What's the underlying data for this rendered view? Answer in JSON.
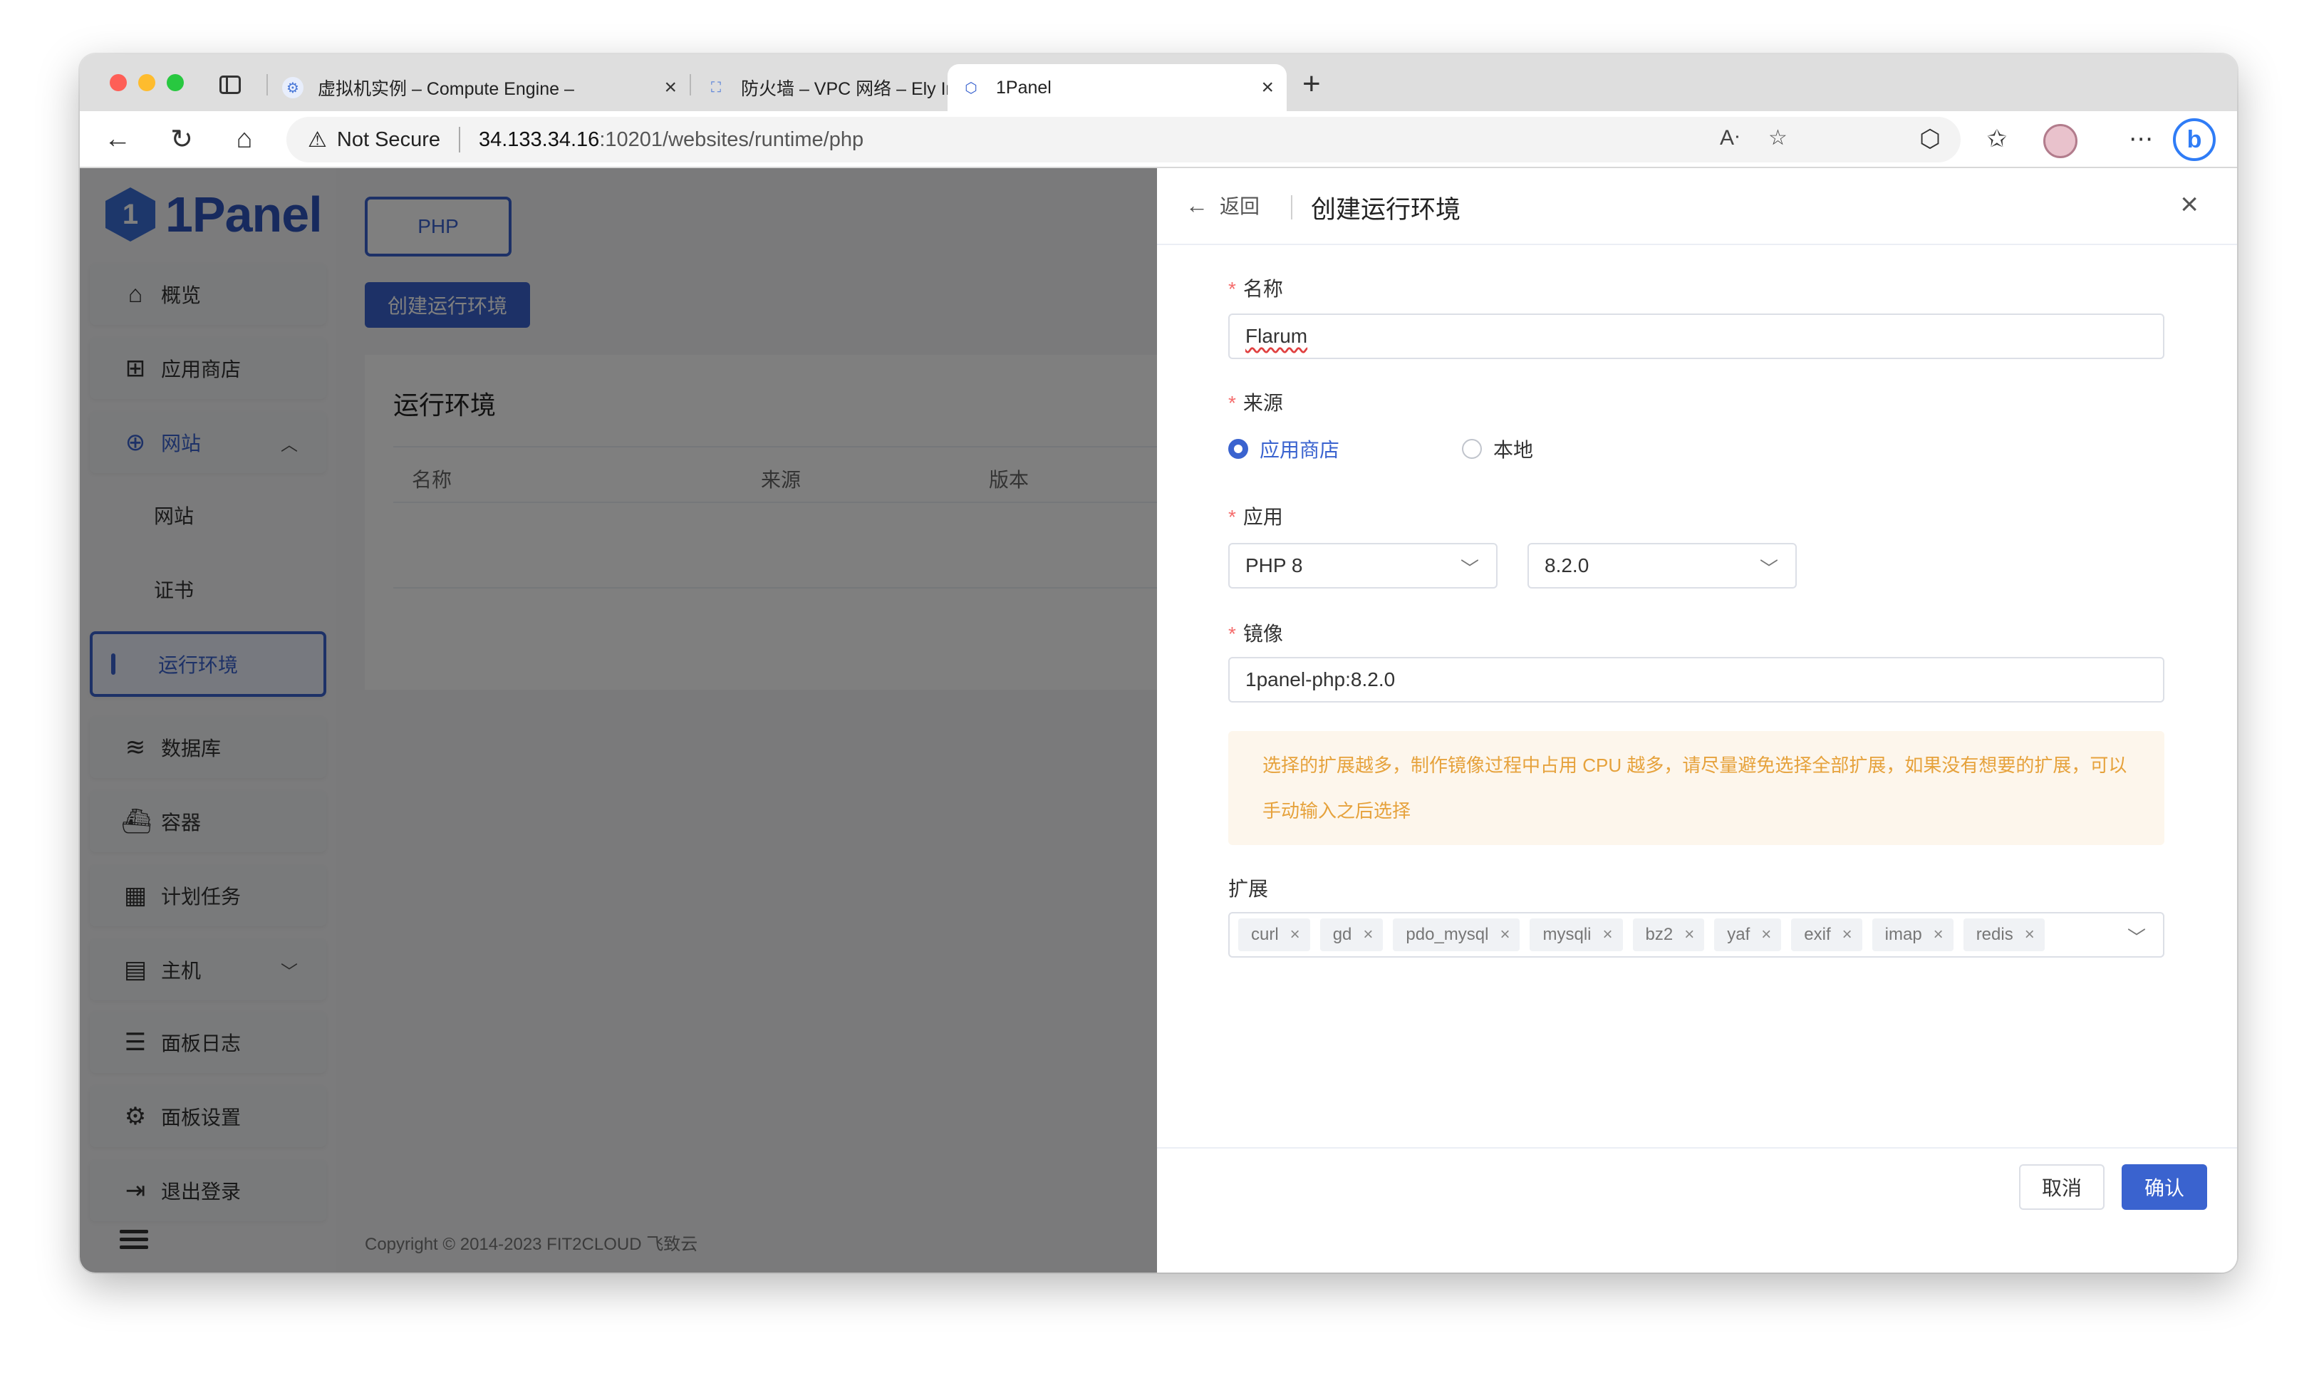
{
  "browser": {
    "tabs": [
      {
        "title": "虚拟机实例 – Compute Engine – ",
        "icon": "compute-engine-icon"
      },
      {
        "title": "防火墙 – VPC 网络 – Ely Internal",
        "icon": "vpc-network-icon"
      },
      {
        "title": "1Panel",
        "icon": "1panel-icon",
        "active": true
      }
    ],
    "security_label": "Not Secure",
    "url_host": "34.133.34.16",
    "url_path": ":10201/websites/runtime/php"
  },
  "sidebar": {
    "logo_text": "1Panel",
    "items": [
      {
        "label": "概览",
        "icon": "home-icon"
      },
      {
        "label": "应用商店",
        "icon": "grid-icon"
      },
      {
        "label": "网站",
        "icon": "globe-icon",
        "expanded": true
      },
      {
        "label": "网站"
      },
      {
        "label": "证书"
      },
      {
        "label": "运行环境",
        "active": true
      },
      {
        "label": "数据库",
        "icon": "layers-icon"
      },
      {
        "label": "容器",
        "icon": "docker-icon"
      },
      {
        "label": "计划任务",
        "icon": "calendar-icon"
      },
      {
        "label": "主机",
        "icon": "server-icon"
      },
      {
        "label": "面板日志",
        "icon": "log-icon"
      },
      {
        "label": "面板设置",
        "icon": "gear-icon"
      },
      {
        "label": "退出登录",
        "icon": "logout-icon"
      }
    ]
  },
  "main": {
    "tab_label": "PHP",
    "create_button": "创建运行环境",
    "card_title": "运行环境",
    "columns": [
      "名称",
      "来源",
      "版本"
    ],
    "copyright": "Copyright © 2014-2023 FIT2CLOUD 飞致云"
  },
  "drawer": {
    "back_label": "返回",
    "title": "创建运行环境",
    "fields": {
      "name_label": "名称",
      "name_value": "Flarum",
      "source_label": "来源",
      "source_options": [
        "应用商店",
        "本地"
      ],
      "source_selected": "应用商店",
      "app_label": "应用",
      "app_value": "PHP 8",
      "version_value": "8.2.0",
      "image_label": "镜像",
      "image_value": "1panel-php:8.2.0",
      "alert_text": "选择的扩展越多，制作镜像过程中占用 CPU 越多，请尽量避免选择全部扩展，如果没有想要的扩展，可以手动输入之后选择",
      "extensions_label": "扩展",
      "extensions": [
        "curl",
        "gd",
        "pdo_mysql",
        "mysqli",
        "bz2",
        "yaf",
        "exif",
        "imap",
        "redis"
      ]
    },
    "cancel_label": "取消",
    "confirm_label": "确认"
  },
  "colors": {
    "primary": "#3a63cf",
    "required": "#f56c6c",
    "warning_text": "#e6a23c",
    "warning_bg": "#fdf6ec"
  }
}
